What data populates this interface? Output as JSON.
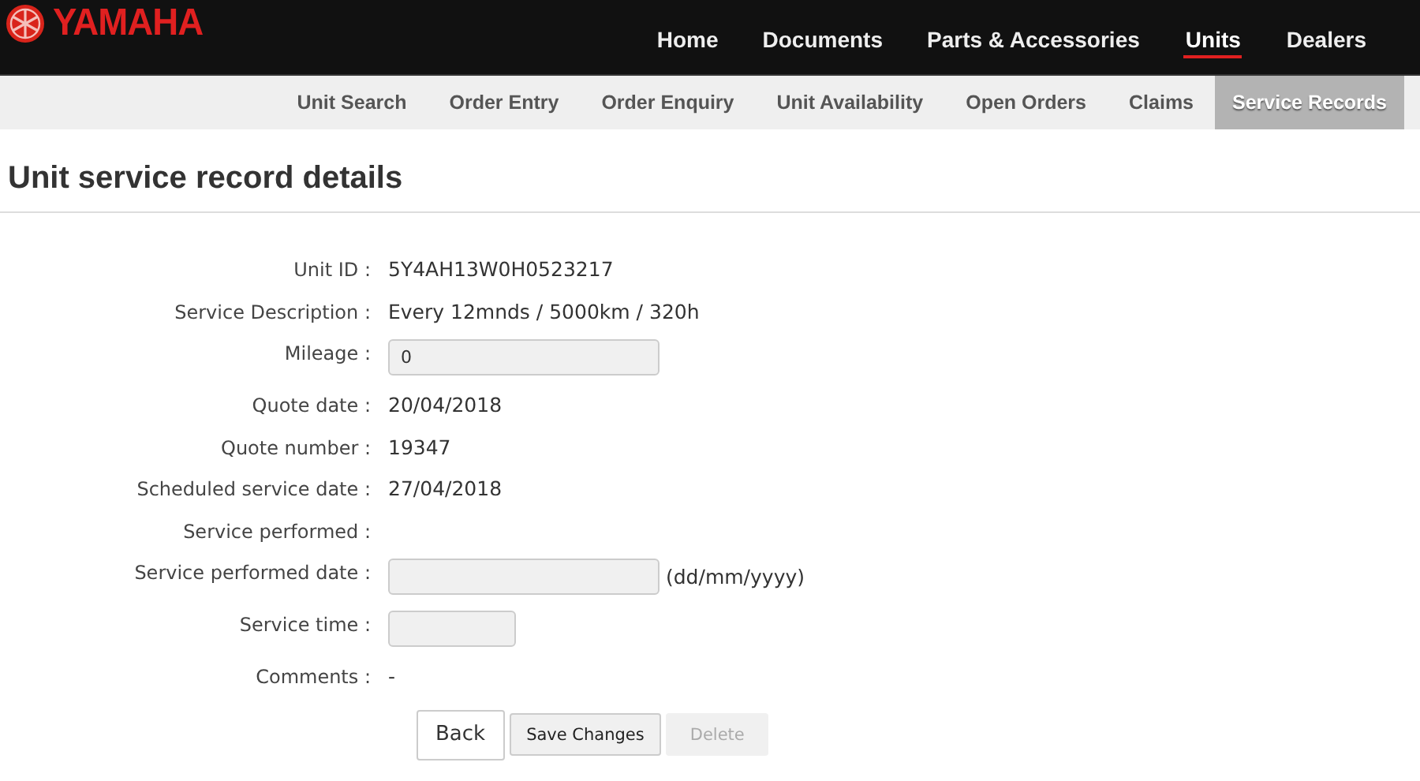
{
  "logo": {
    "text": "YAMAHA"
  },
  "main_nav": [
    {
      "label": "Home",
      "selected": false
    },
    {
      "label": "Documents",
      "selected": false
    },
    {
      "label": "Parts & Accessories",
      "selected": false
    },
    {
      "label": "Units",
      "selected": true
    },
    {
      "label": "Dealers",
      "selected": false
    }
  ],
  "sub_nav": [
    {
      "label": "Unit Search",
      "selected": false
    },
    {
      "label": "Order Entry",
      "selected": false
    },
    {
      "label": "Order Enquiry",
      "selected": false
    },
    {
      "label": "Unit Availability",
      "selected": false
    },
    {
      "label": "Open Orders",
      "selected": false
    },
    {
      "label": "Claims",
      "selected": false
    },
    {
      "label": "Service Records",
      "selected": true
    }
  ],
  "page_title": "Unit service record details",
  "fields": [
    {
      "label": "Unit ID :",
      "kind": "text",
      "value": "5Y4AH13W0H0523217"
    },
    {
      "label": "Service Description :",
      "kind": "text",
      "value": "Every 12mnds / 5000km / 320h"
    },
    {
      "label": "Mileage :",
      "kind": "input",
      "value": "0"
    },
    {
      "label": "Quote date :",
      "kind": "text",
      "value": "20/04/2018"
    },
    {
      "label": "Quote number :",
      "kind": "text",
      "value": "19347"
    },
    {
      "label": "Scheduled service date :",
      "kind": "text",
      "value": "27/04/2018"
    },
    {
      "label": "Service performed :",
      "kind": "blank"
    },
    {
      "label": "Service performed date :",
      "kind": "input",
      "hint": "(dd/mm/yyyy)"
    },
    {
      "label": "Service time :",
      "kind": "short_input"
    },
    {
      "label": "Comments :",
      "kind": "text",
      "value": "-"
    }
  ],
  "buttons": [
    {
      "label": "Back",
      "kind": "outline",
      "disabled": false
    },
    {
      "label": "Save Changes",
      "kind": "plain",
      "disabled": false
    },
    {
      "label": "Delete",
      "kind": "plain",
      "disabled": true
    }
  ]
}
